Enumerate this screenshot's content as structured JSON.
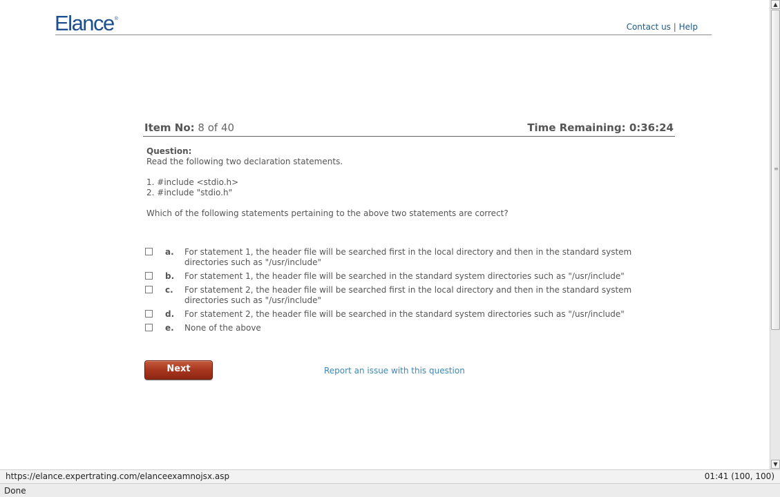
{
  "header": {
    "logo_text": "Elance",
    "logo_mark": "®",
    "contact_label": "Contact us",
    "separator": "|",
    "help_label": "Help"
  },
  "item_bar": {
    "item_label": "Item No:",
    "item_value": "8 of 40",
    "time_label": "Time Remaining:",
    "time_value": "0:36:24"
  },
  "question": {
    "label": "Question:",
    "lines": [
      "Read the following two declaration statements.",
      "",
      "1. #include <stdio.h>",
      "2. #include \"stdio.h\"",
      "",
      "Which of the following statements pertaining to the above two statements are correct?"
    ]
  },
  "answers": [
    {
      "letter": "a.",
      "text": "For statement 1, the header file will be searched first in the local directory and then in the standard system directories such as \"/usr/include\"",
      "checked": false
    },
    {
      "letter": "b.",
      "text": "For statement 1, the header file will be searched in the standard system directories such as \"/usr/include\"",
      "checked": false
    },
    {
      "letter": "c.",
      "text": "For statement 2, the header file will be searched first in the local directory and then in the standard system directories such as \"/usr/include\"",
      "checked": false
    },
    {
      "letter": "d.",
      "text": "For statement 2, the header file will be searched in the standard system directories such as \"/usr/include\"",
      "checked": false
    },
    {
      "letter": "e.",
      "text": "None of the above",
      "checked": false
    }
  ],
  "actions": {
    "next_label": "Next",
    "report_label": "Report an issue with this question"
  },
  "url_bar": {
    "url": "https://elance.expertrating.com/elanceexamnojsx.asp",
    "info": "01:41  (100, 100)"
  },
  "status": {
    "text": "Done"
  },
  "icons": {
    "scroll_up": "triangle-up",
    "scroll_down": "triangle-down",
    "checkbox": "empty-square"
  }
}
